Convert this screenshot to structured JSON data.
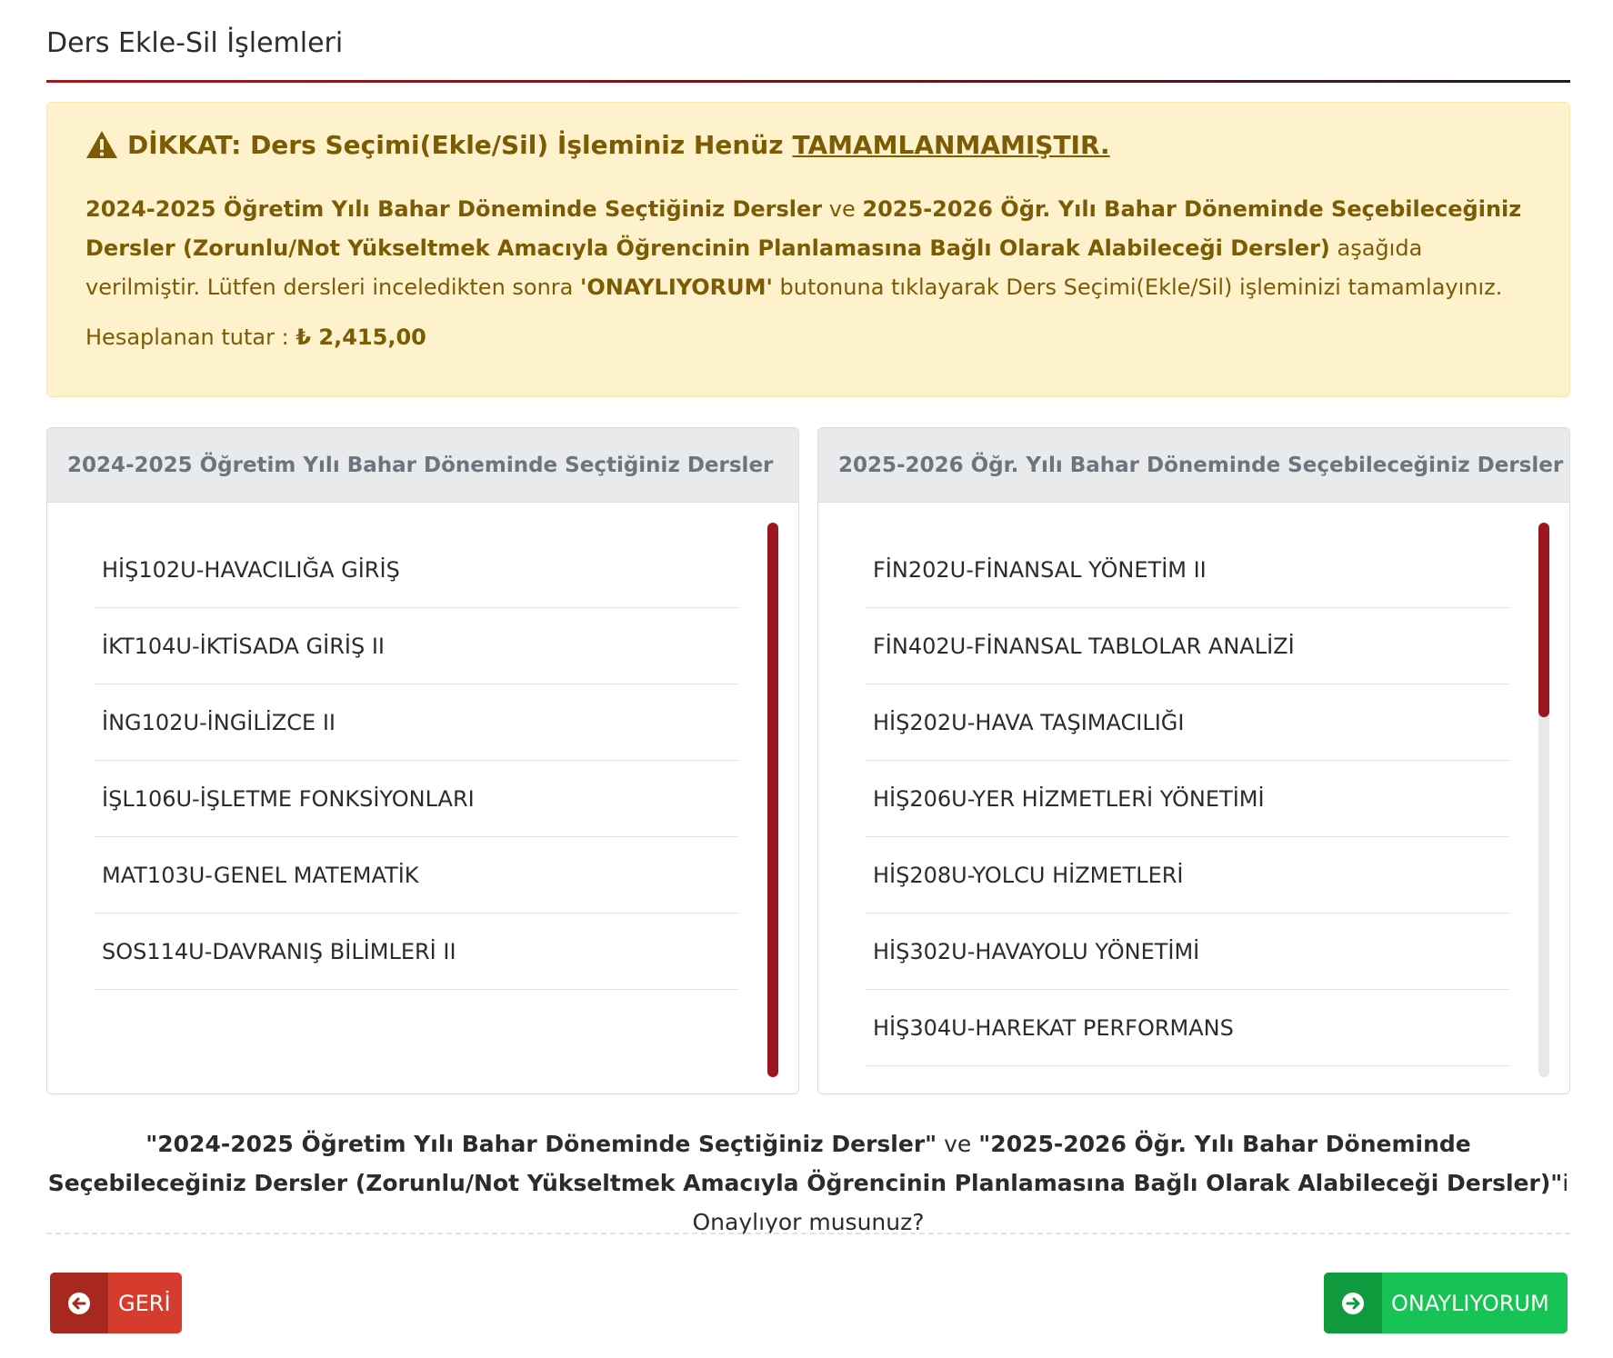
{
  "page": {
    "title": "Ders Ekle-Sil İşlemleri"
  },
  "alert": {
    "heading_prefix": "DİKKAT: Ders Seçimi(Ekle/Sil) İşleminiz Henüz",
    "heading_emphasis": "TAMAMLANMAMIŞTIR.",
    "body_bold_1": "2024-2025 Öğretim Yılı Bahar Döneminde Seçtiğiniz Dersler",
    "body_text_1": "ve",
    "body_bold_2": "2025-2026 Öğr. Yılı Bahar Döneminde Seçebileceğiniz Dersler (Zorunlu/Not Yükseltmek Amacıyla Öğrencinin Planlamasına Bağlı Olarak Alabileceği Dersler)",
    "body_text_2": "aşağıda verilmiştir. Lütfen dersleri inceledikten sonra",
    "body_bold_3": "'ONAYLIYORUM'",
    "body_text_3": "butonuna tıklayarak Ders Seçimi(Ekle/Sil) işleminizi tamamlayınız.",
    "amount_label": "Hesaplanan tutar :",
    "amount_value": "₺ 2,415,00",
    "icon": "warning-triangle-icon"
  },
  "left_panel": {
    "title": "2024-2025 Öğretim Yılı Bahar Döneminde Seçtiğiniz Dersler",
    "courses": [
      "HİŞ102U-HAVACILIĞA GİRİŞ",
      "İKT104U-İKTİSADA GİRİŞ II",
      "İNG102U-İNGİLİZCE II",
      "İŞL106U-İŞLETME FONKSİYONLARI",
      "MAT103U-GENEL MATEMATİK",
      "SOS114U-DAVRANIŞ BİLİMLERİ II"
    ],
    "scroll_visible_fraction": 1.0
  },
  "right_panel": {
    "title": "2025-2026 Öğr. Yılı Bahar Döneminde Seçebileceğiniz Dersler",
    "courses": [
      "FİN202U-FİNANSAL YÖNETİM II",
      "FİN402U-FİNANSAL TABLOLAR ANALİZİ",
      "HİŞ202U-HAVA TAŞIMACILIĞI",
      "HİŞ206U-YER HİZMETLERİ YÖNETİMİ",
      "HİŞ208U-YOLCU HİZMETLERİ",
      "HİŞ302U-HAVAYOLU YÖNETİMİ",
      "HİŞ304U-HAREKAT PERFORMANS"
    ],
    "scroll_visible_fraction": 0.35
  },
  "confirm": {
    "quote_1": "\"2024-2025 Öğretim Yılı Bahar Döneminde Seçtiğiniz Dersler\"",
    "conj": "ve",
    "quote_2": "\"2025-2026 Öğr. Yılı Bahar Döneminde Seçebileceğiniz Dersler (Zorunlu/Not Yükseltmek Amacıyla Öğrencinin Planlamasına Bağlı Olarak Alabileceği Dersler)\"",
    "suffix": "i Onaylıyor musunuz?"
  },
  "buttons": {
    "back_label": "GERİ",
    "back_icon": "arrow-circle-left-icon",
    "confirm_label": "ONAYLIYORUM",
    "confirm_icon": "arrow-circle-right-icon"
  },
  "colors": {
    "accent_red": "#9d1520",
    "alert_bg": "#fdf2cc",
    "alert_text": "#7c5b05",
    "back_button": "#d63c2e",
    "confirm_button": "#17c354"
  }
}
